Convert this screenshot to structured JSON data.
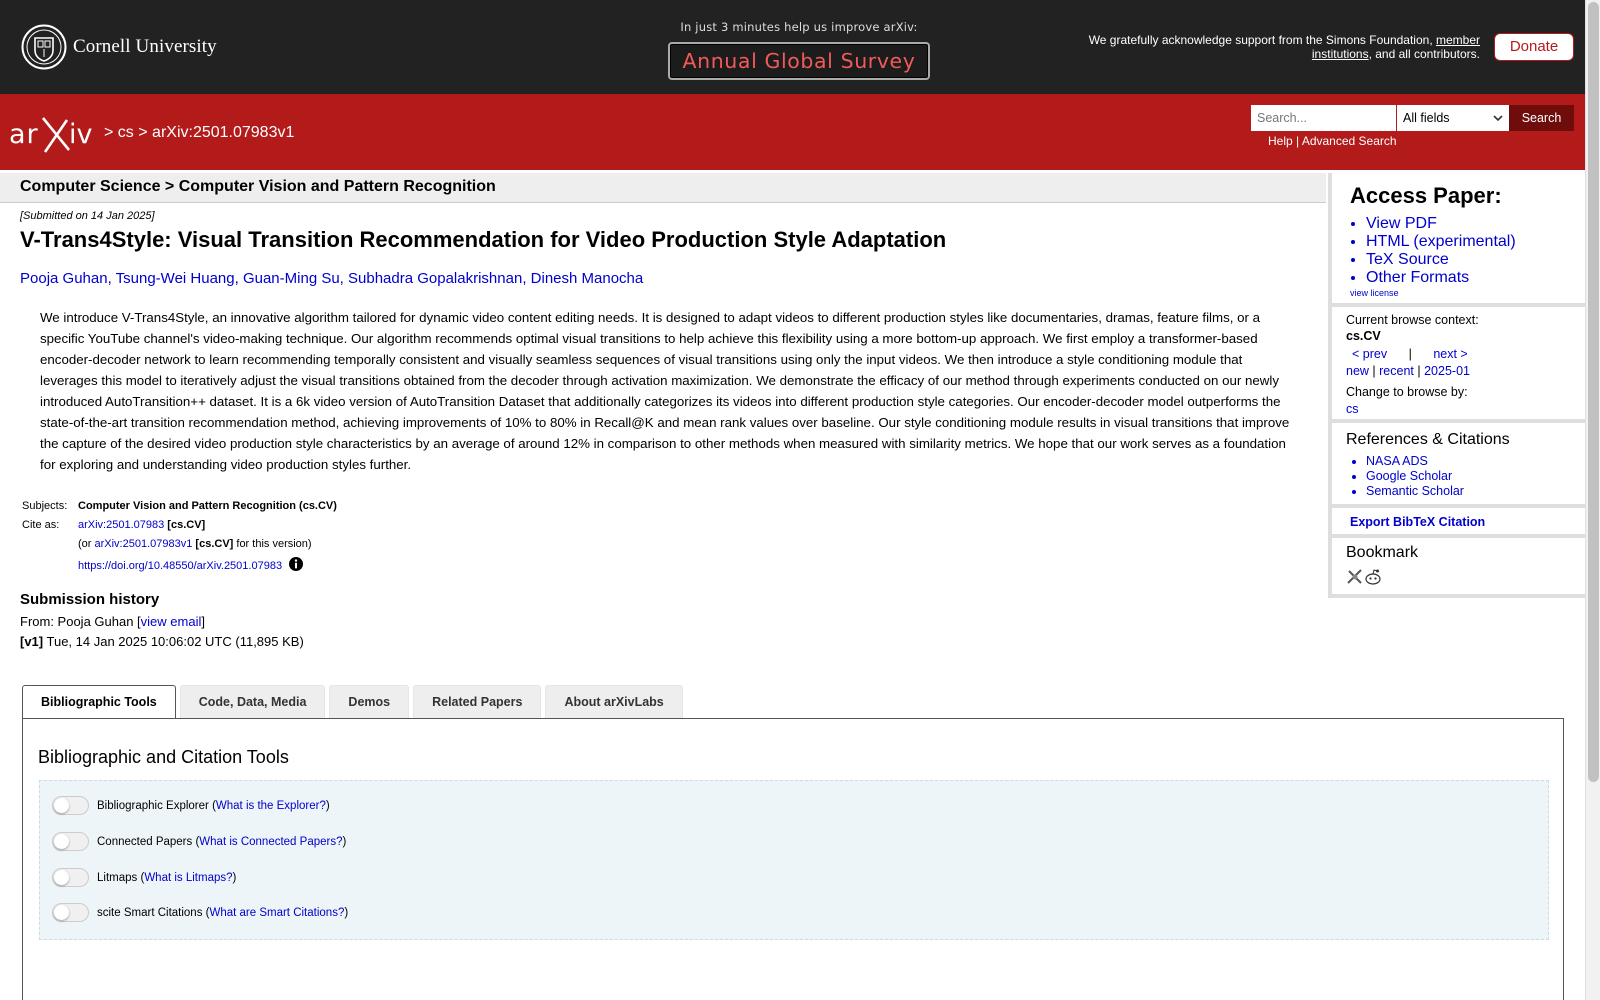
{
  "topbar": {
    "university": "Cornell University",
    "survey_prompt": "In just 3 minutes help us improve arXiv:",
    "survey_button": "Annual Global Survey",
    "support_text_1": "We gratefully acknowledge support from the Simons Foundation, ",
    "support_link_1": "member institutions",
    "support_text_2": ", and all contributors.",
    "donate_label": "Donate"
  },
  "header": {
    "breadcrumb_sep1": ">",
    "breadcrumb_cs": "cs",
    "breadcrumb_sep2": ">",
    "breadcrumb_id": "arXiv:2501.07983v1",
    "search_placeholder": "Search...",
    "search_field": "All fields",
    "search_button": "Search",
    "help_link": "Help",
    "link_sep": " | ",
    "advanced_link": "Advanced Search"
  },
  "paper": {
    "subject_heading": "Computer Science > Computer Vision and Pattern Recognition",
    "submitted": "[Submitted on 14 Jan 2025]",
    "title": "V-Trans4Style: Visual Transition Recommendation for Video Production Style Adaptation",
    "authors": [
      "Pooja Guhan",
      "Tsung-Wei Huang",
      "Guan-Ming Su",
      "Subhadra Gopalakrishnan",
      "Dinesh Manocha"
    ],
    "author_sep": ", ",
    "abstract": "We introduce V-Trans4Style, an innovative algorithm tailored for dynamic video content editing needs. It is designed to adapt videos to different production styles like documentaries, dramas, feature films, or a specific YouTube channel's video-making technique. Our algorithm recommends optimal visual transitions to help achieve this flexibility using a more bottom-up approach. We first employ a transformer-based encoder-decoder network to learn recommending temporally consistent and visually seamless sequences of visual transitions using only the input videos. We then introduce a style conditioning module that leverages this model to iteratively adjust the visual transitions obtained from the decoder through activation maximization. We demonstrate the efficacy of our method through experiments conducted on our newly introduced AutoTransition++ dataset. It is a 6k video version of AutoTransition Dataset that additionally categorizes its videos into different production style categories. Our encoder-decoder model outperforms the state-of-the-art transition recommendation method, achieving improvements of 10% to 80% in Recall@K and mean rank values over baseline. Our style conditioning module results in visual transitions that improve the capture of the desired video production style characteristics by an average of around 12% in comparison to other methods when measured with similarity metrics. We hope that our work serves as a foundation for exploring and understanding video production styles further.",
    "subjects_label": "Subjects:",
    "subjects_value": "Computer Vision and Pattern Recognition (cs.CV)",
    "cite_label": "Cite as:",
    "cite_id": "arXiv:2501.07983",
    "cite_cat": " [cs.CV]",
    "cite_or_open": "(or ",
    "cite_version_id": "arXiv:2501.07983v1",
    "cite_version_cat": " [cs.CV]",
    "cite_or_close": " for this version)",
    "doi": "https://doi.org/10.48550/arXiv.2501.07983",
    "history_heading": "Submission history",
    "history_from": "From: Pooja Guhan [",
    "history_email": "view email",
    "history_from_close": "]",
    "history_v1_label": "[v1]",
    "history_v1_text": " Tue, 14 Jan 2025 10:06:02 UTC (11,895 KB)"
  },
  "tabs": [
    {
      "label": "Bibliographic Tools",
      "active": true
    },
    {
      "label": "Code, Data, Media",
      "active": false
    },
    {
      "label": "Demos",
      "active": false
    },
    {
      "label": "Related Papers",
      "active": false
    },
    {
      "label": "About arXivLabs",
      "active": false
    }
  ],
  "tab_panel": {
    "heading": "Bibliographic and Citation Tools",
    "tools": [
      {
        "name": "Bibliographic Explorer",
        "help": "What is the Explorer?"
      },
      {
        "name": "Connected Papers",
        "help": "What is Connected Papers?"
      },
      {
        "name": "Litmaps",
        "help": "What is Litmaps?"
      },
      {
        "name": "scite Smart Citations",
        "help": "What are Smart Citations?"
      }
    ]
  },
  "sidebar": {
    "access_heading": "Access Paper:",
    "access_links": [
      "View PDF",
      "HTML (experimental)",
      "TeX Source",
      "Other Formats"
    ],
    "view_license": "view license",
    "browse_context_label": "Current browse context:",
    "browse_context": "cs.CV",
    "prev": "< prev",
    "nav_bar": "|",
    "next": "next >",
    "new": "new",
    "recent": "recent",
    "month": "2025-01",
    "change_browse_label": "Change to browse by:",
    "browse_cs": "cs",
    "refs_heading": "References & Citations",
    "refs_links": [
      "NASA ADS",
      "Google Scholar",
      "Semantic Scholar"
    ],
    "export_bibtex": "Export BibTeX Citation",
    "bookmark_heading": "Bookmark"
  },
  "colors": {
    "arxiv_red": "#b31b1b",
    "top_bar": "#222222",
    "link": "#0000cc"
  }
}
